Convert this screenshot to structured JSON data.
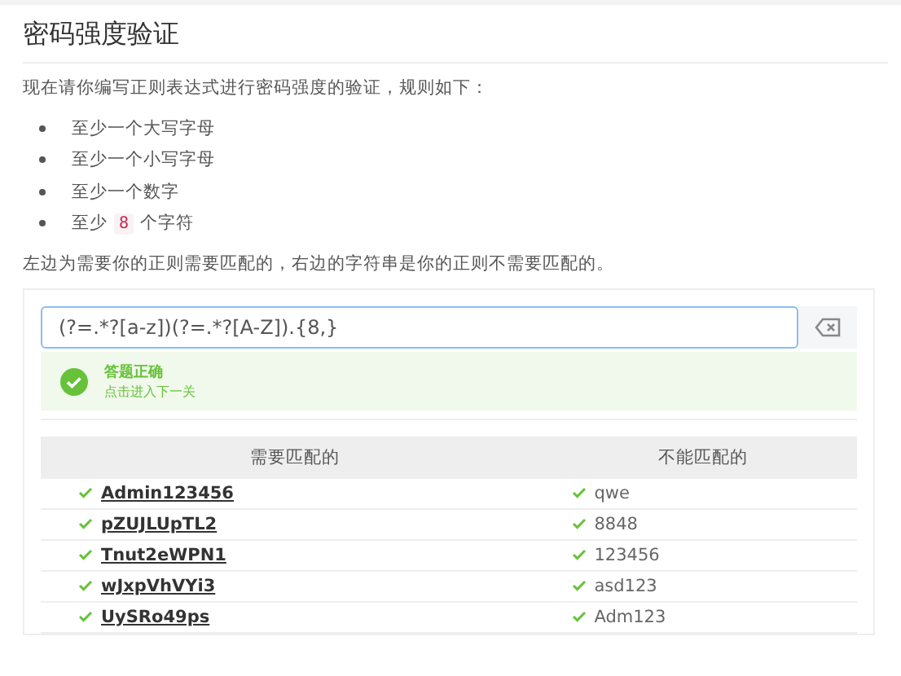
{
  "title": "密码强度验证",
  "intro": "现在请你编写正则表达式进行密码强度的验证，规则如下：",
  "rules": [
    "至少一个大写字母",
    "至少一个小写字母",
    "至少一个数字",
    {
      "before": "至少",
      "code": "8",
      "after": "个字符"
    }
  ],
  "note": "左边为需要你的正则需要匹配的，右边的字符串是你的正则不需要匹配的。",
  "regex_input": {
    "value": "(?=.*?[a-z])(?=.*?[A-Z]).{8,}"
  },
  "result": {
    "success": true,
    "title": "答题正确",
    "subtitle": "点击进入下一关"
  },
  "table": {
    "columns": [
      "需要匹配的",
      "不能匹配的"
    ],
    "rows": [
      {
        "match": {
          "text": "Admin123456",
          "passed": true
        },
        "nomatch": {
          "text": "qwe",
          "passed": true
        }
      },
      {
        "match": {
          "text": "pZUJLUpTL2",
          "passed": true
        },
        "nomatch": {
          "text": "8848",
          "passed": true
        }
      },
      {
        "match": {
          "text": "Tnut2eWPN1",
          "passed": true
        },
        "nomatch": {
          "text": "123456",
          "passed": true
        }
      },
      {
        "match": {
          "text": "wJxpVhVYi3",
          "passed": true
        },
        "nomatch": {
          "text": "asd123",
          "passed": true
        }
      },
      {
        "match": {
          "text": "UySRo49ps",
          "passed": true
        },
        "nomatch": {
          "text": "Adm123",
          "passed": true
        }
      }
    ]
  }
}
